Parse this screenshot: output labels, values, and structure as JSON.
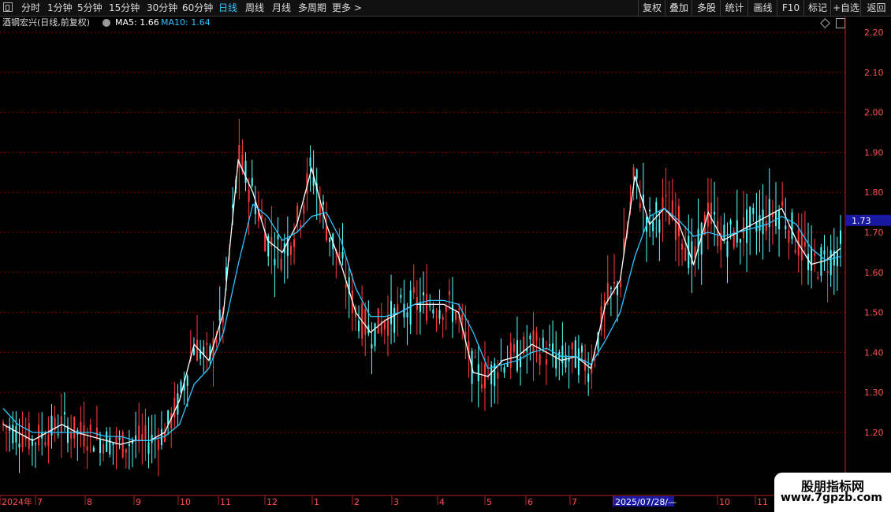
{
  "toolbar": {
    "periods": [
      "分时",
      "1分钟",
      "5分钟",
      "15分钟",
      "30分钟",
      "60分钟",
      "日线",
      "周线",
      "月线",
      "多周期",
      "更多 >"
    ],
    "active": "日线",
    "right_buttons": [
      "复权",
      "叠加",
      "多股",
      "统计",
      "画线",
      "F10",
      "标记",
      "+自选",
      "返回"
    ]
  },
  "legend": {
    "title": "酒钢宏兴(日线,前复权)",
    "ma5_text": "MA5: 1.66",
    "ma10_text": "MA10: 1.64",
    "ma5_color": "#ffffff",
    "ma10_color": "#31c3ff"
  },
  "price_tag": "1.73",
  "y_axis_labels": [
    "2.20",
    "2.10",
    "2.00",
    "1.90",
    "1.80",
    "1.70",
    "1.60",
    "1.50",
    "1.40",
    "1.30",
    "1.20"
  ],
  "x_axis_labels": [
    "2024年",
    "7",
    "8",
    "9",
    "10",
    "11",
    "12",
    "1",
    "2",
    "3",
    "4",
    "5",
    "6",
    "7",
    "2025/07/28/—",
    "10",
    "11"
  ],
  "watermark": {
    "line1": "股朋指标网",
    "line2": "www.7gpzb.com"
  },
  "colors": {
    "up": "#ff3b3b",
    "down": "#55ffff",
    "grid": "#8b0000",
    "axis": "#b02020",
    "highlight": "#1818a0"
  },
  "chart_data": {
    "type": "line",
    "title": "酒钢宏兴(日线,前复权)",
    "ylim": [
      1.12,
      2.24
    ],
    "series": [
      {
        "name": "MA5",
        "values": [
          1.22,
          1.2,
          1.18,
          1.2,
          1.22,
          1.2,
          1.19,
          1.18,
          1.17,
          1.18,
          1.18,
          1.2,
          1.28,
          1.42,
          1.38,
          1.5,
          1.88,
          1.8,
          1.68,
          1.65,
          1.72,
          1.86,
          1.72,
          1.62,
          1.5,
          1.45,
          1.48,
          1.5,
          1.52,
          1.52,
          1.52,
          1.5,
          1.35,
          1.34,
          1.38,
          1.39,
          1.42,
          1.4,
          1.38,
          1.39,
          1.36,
          1.52,
          1.58,
          1.84,
          1.72,
          1.76,
          1.72,
          1.62,
          1.75,
          1.68,
          1.7,
          1.72,
          1.74,
          1.76,
          1.68,
          1.62,
          1.63,
          1.66
        ]
      },
      {
        "name": "MA10",
        "values": [
          1.26,
          1.22,
          1.2,
          1.2,
          1.2,
          1.2,
          1.2,
          1.19,
          1.19,
          1.18,
          1.18,
          1.19,
          1.22,
          1.32,
          1.36,
          1.45,
          1.62,
          1.77,
          1.74,
          1.68,
          1.7,
          1.74,
          1.75,
          1.68,
          1.56,
          1.49,
          1.49,
          1.5,
          1.52,
          1.53,
          1.53,
          1.52,
          1.45,
          1.36,
          1.37,
          1.38,
          1.4,
          1.41,
          1.39,
          1.39,
          1.37,
          1.43,
          1.5,
          1.64,
          1.74,
          1.76,
          1.73,
          1.69,
          1.7,
          1.69,
          1.7,
          1.71,
          1.72,
          1.74,
          1.72,
          1.66,
          1.63,
          1.64
        ]
      }
    ]
  }
}
